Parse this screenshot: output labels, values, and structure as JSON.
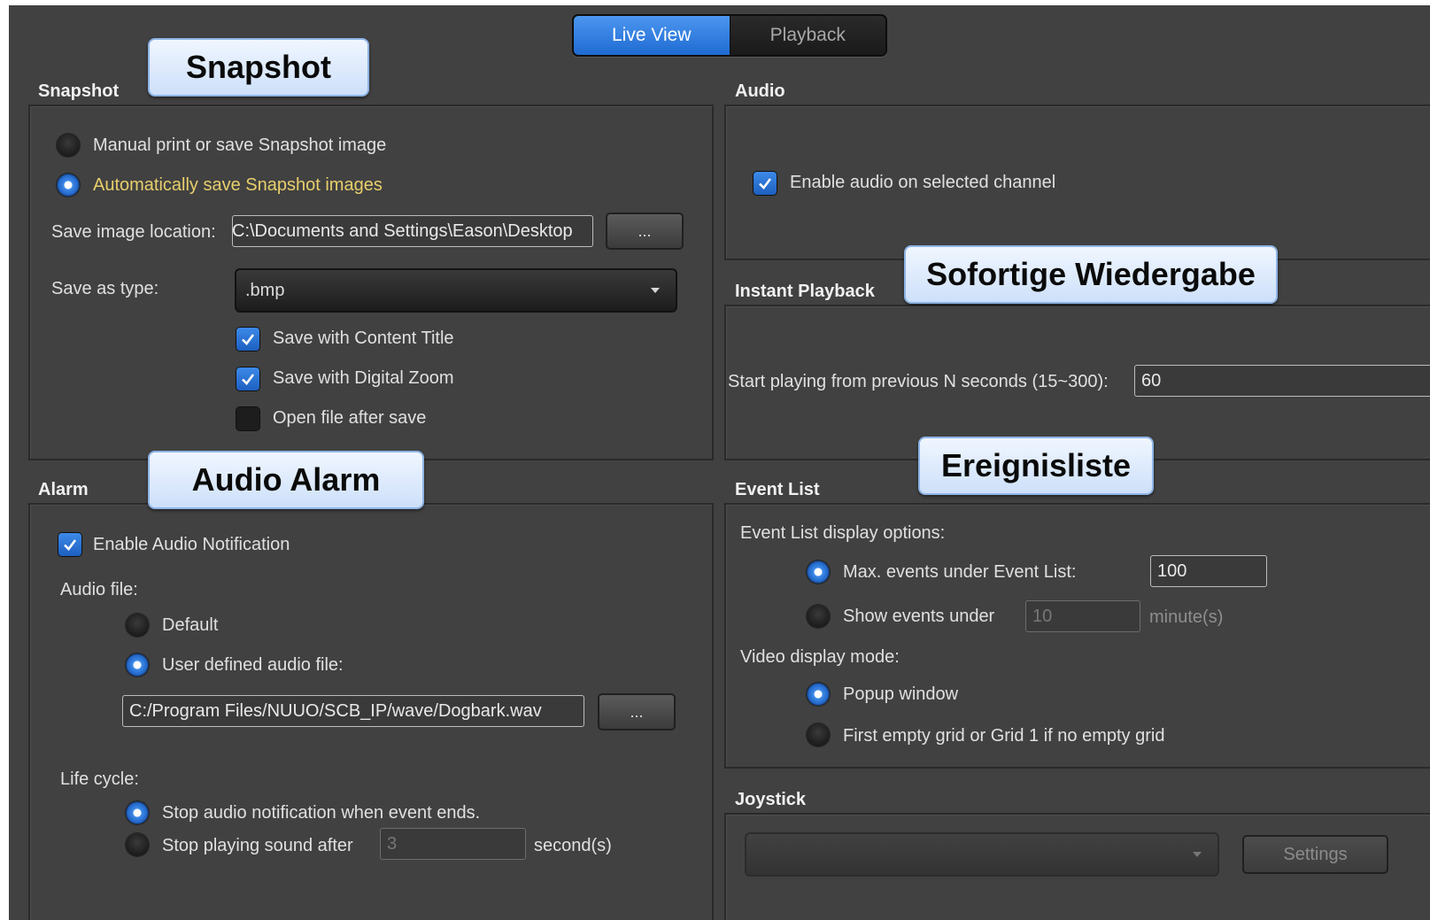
{
  "view_toggle": {
    "live_view": "Live View",
    "playback": "Playback"
  },
  "snapshot": {
    "title": "Snapshot",
    "manual_label": "Manual print or save Snapshot image",
    "auto_label": "Automatically save Snapshot images",
    "location_label": "Save image location:",
    "location_value": "C:\\Documents and Settings\\Eason\\Desktop",
    "browse_label": "...",
    "type_label": "Save as type:",
    "type_value": ".bmp",
    "content_title_label": "Save with Content Title",
    "digital_zoom_label": "Save with Digital Zoom",
    "open_after_label": "Open file after save"
  },
  "audio": {
    "title": "Audio",
    "enable_label": "Enable audio on selected channel"
  },
  "instant_playback": {
    "title": "Instant Playback",
    "start_label": "Start playing from previous N seconds (15~300):",
    "start_value": "60"
  },
  "alarm": {
    "title": "Alarm",
    "enable_label": "Enable Audio Notification",
    "audio_file_label": "Audio file:",
    "default_label": "Default",
    "user_defined_label": "User defined audio file:",
    "file_path": "C:/Program Files/NUUO/SCB_IP/wave/Dogbark.wav",
    "browse_label": "...",
    "life_cycle_label": "Life cycle:",
    "stop_on_end_label": "Stop audio notification when event ends.",
    "stop_after_label": "Stop playing sound after",
    "stop_after_value": "3",
    "seconds_unit": "second(s)"
  },
  "event_list": {
    "title": "Event List",
    "display_options_label": "Event List display options:",
    "max_events_label": "Max. events under Event List:",
    "max_events_value": "100",
    "show_under_label": "Show events under",
    "show_under_value": "10",
    "minutes_unit": "minute(s)",
    "video_mode_label": "Video display mode:",
    "popup_label": "Popup window",
    "grid_label": "First empty grid or Grid 1 if no empty grid"
  },
  "joystick": {
    "title": "Joystick",
    "select_value": "",
    "settings_label": "Settings"
  },
  "callouts": {
    "snapshot": "Snapshot",
    "audio_alarm": "Audio Alarm",
    "instant_playback": "Sofortige Wiedergabe",
    "event_list": "Ereignisliste"
  },
  "colors": {
    "background": "#414141",
    "accent": "#2f7fe0",
    "highlight_text": "#e8cf6c",
    "callout": "#d9e8fc"
  }
}
